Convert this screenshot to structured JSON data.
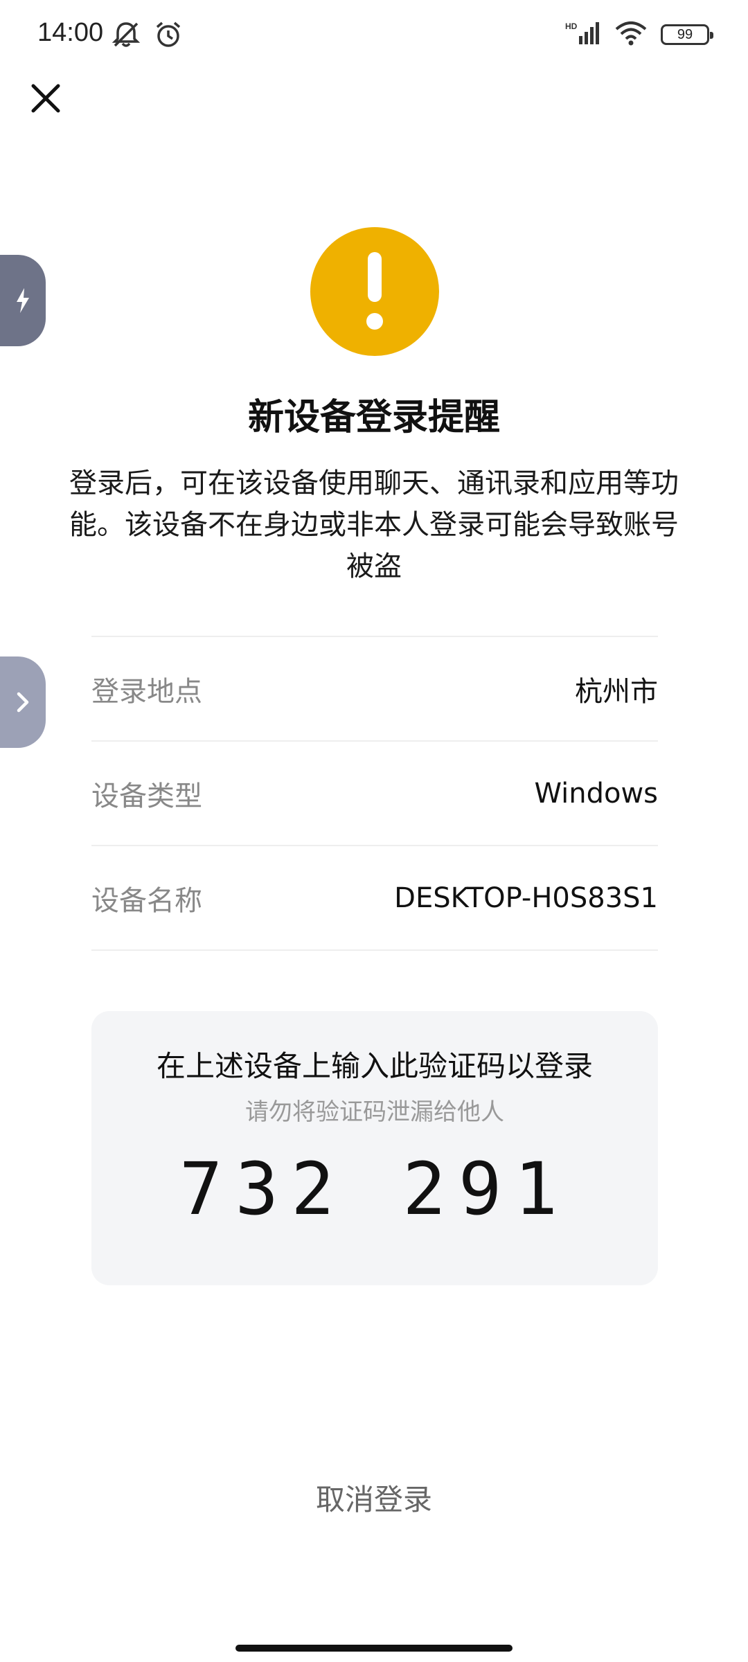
{
  "status_bar": {
    "time": "14:00",
    "battery": "99",
    "icons": [
      "mute-notification-icon",
      "alarm-icon",
      "hd-signal-icon",
      "wifi-icon",
      "battery-icon"
    ]
  },
  "header": {
    "close_icon": "close-icon"
  },
  "alert": {
    "icon": "warning-icon",
    "icon_color": "#efb100",
    "title": "新设备登录提醒",
    "description": "登录后，可在该设备使用聊天、通讯录和应用等功能。该设备不在身边或非本人登录可能会导致账号被盗"
  },
  "details": [
    {
      "label": "登录地点",
      "value": "杭州市"
    },
    {
      "label": "设备类型",
      "value": "Windows"
    },
    {
      "label": "设备名称",
      "value": "DESKTOP-H0S83S1"
    }
  ],
  "code_card": {
    "title": "在上述设备上输入此验证码以登录",
    "subtitle": "请勿将验证码泄漏给他人",
    "code": "732 291"
  },
  "actions": {
    "cancel_label": "取消登录"
  },
  "edge_tabs": [
    "flash-icon",
    "chevron-right-icon"
  ]
}
